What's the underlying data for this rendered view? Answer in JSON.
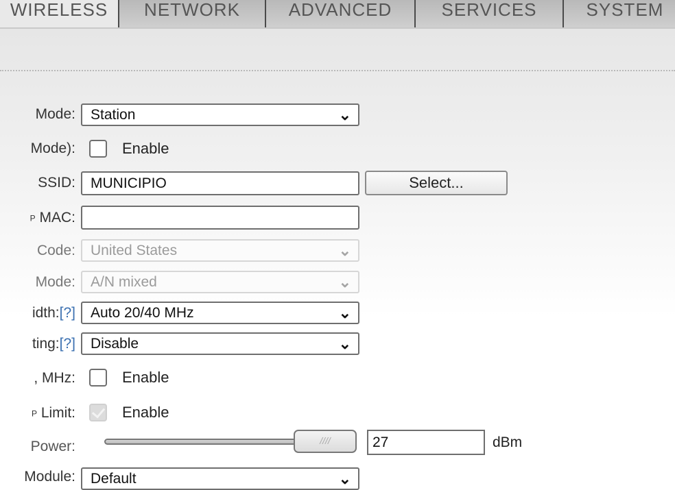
{
  "tabs": [
    {
      "label": "WIRELESS",
      "active": true
    },
    {
      "label": "NETWORK"
    },
    {
      "label": "ADVANCED"
    },
    {
      "label": "SERVICES"
    },
    {
      "label": "SYSTEM"
    }
  ],
  "form": {
    "wireless_mode": {
      "label": "Mode:",
      "value": "Station"
    },
    "wds": {
      "label": "Mode):",
      "checkbox_label": "Enable"
    },
    "ssid": {
      "label": "SSID:",
      "value": "MUNICIPIO",
      "select_button": "Select..."
    },
    "ap_mac": {
      "label": "MAC:",
      "prefix": "P",
      "value": ""
    },
    "country_code": {
      "label": "Code:",
      "value": "United States"
    },
    "ieee_mode": {
      "label": "Mode:",
      "value": "A/N mixed"
    },
    "channel_width": {
      "label": "idth:",
      "help": "[?]",
      "value": "Auto 20/40 MHz"
    },
    "channel_shifting": {
      "label": "ting:",
      "help": "[?]",
      "value": "Disable"
    },
    "frequency_list": {
      "label": ", MHz:",
      "checkbox_label": "Enable"
    },
    "eirp_limit": {
      "label": "Limit:",
      "prefix": "P",
      "checkbox_label": "Enable"
    },
    "output_power": {
      "label": "Power:",
      "value": "27",
      "unit": "dBm",
      "handle_text": "////"
    },
    "data_rate_module": {
      "label": "Module:",
      "value": "Default"
    }
  }
}
